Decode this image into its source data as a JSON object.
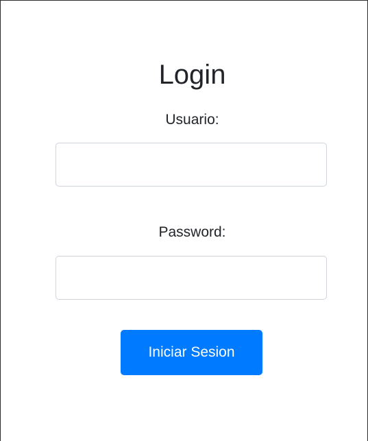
{
  "login": {
    "title": "Login",
    "username_label": "Usuario:",
    "username_value": "",
    "password_label": "Password:",
    "password_value": "",
    "submit_label": "Iniciar Sesion"
  },
  "colors": {
    "primary": "#007bff",
    "border": "#ced4da",
    "text": "#212529"
  }
}
